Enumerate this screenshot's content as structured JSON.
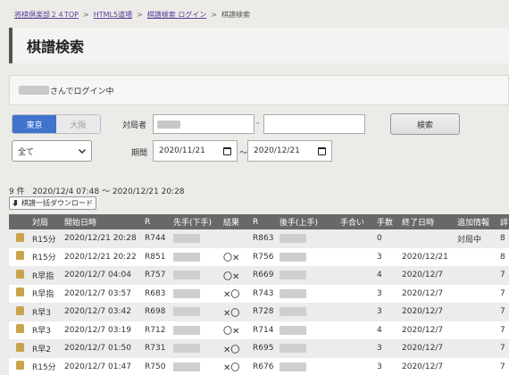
{
  "breadcrumb": {
    "items": [
      "将棋倶楽部２４TOP",
      "HTML5道場",
      "棋譜検索 ログイン",
      "棋譜検索"
    ],
    "sep": ">"
  },
  "page_title": "棋譜検索",
  "login": {
    "text": "さんでログイン中"
  },
  "region_tabs": {
    "tokyo": "東京",
    "osaka": "大阪"
  },
  "type_select": {
    "value": "全て"
  },
  "filters": {
    "opponent_label": "対局者",
    "dash": "-",
    "period_label": "期間",
    "date_from": "2020/11/21",
    "tilde": "～",
    "date_to": "2020/12/21",
    "search_label": "検索"
  },
  "results": {
    "count": "9 件",
    "range": "2020/12/4 07:48 ～ 2020/12/21 20:28",
    "download_label": "棋譜一括ダウンロード"
  },
  "table": {
    "headers": [
      "",
      "対局",
      "開始日時",
      "R",
      "先手(下手)",
      "結果",
      "R",
      "後手(上手)",
      "手合い",
      "手数",
      "終了日時",
      "追加情報",
      "詳"
    ],
    "rows": [
      {
        "game": "R15分",
        "start": "2020/12/21 20:28",
        "r1": "R744",
        "result": "",
        "r2": "R863",
        "handicap": "",
        "moves": "0",
        "end": "",
        "info": "対局中",
        "extra": "8"
      },
      {
        "game": "R15分",
        "start": "2020/12/21 20:22",
        "r1": "R851",
        "result": "〇✕",
        "r2": "R756",
        "handicap": "",
        "moves": "3",
        "end": "2020/12/21",
        "info": "",
        "extra": "8"
      },
      {
        "game": "R早指",
        "start": "2020/12/7 04:04",
        "r1": "R757",
        "result": "〇✕",
        "r2": "R669",
        "handicap": "",
        "moves": "4",
        "end": "2020/12/7",
        "info": "",
        "extra": "7"
      },
      {
        "game": "R早指",
        "start": "2020/12/7 03:57",
        "r1": "R683",
        "result": "✕〇",
        "r2": "R743",
        "handicap": "",
        "moves": "3",
        "end": "2020/12/7",
        "info": "",
        "extra": "7"
      },
      {
        "game": "R早3",
        "start": "2020/12/7 03:42",
        "r1": "R698",
        "result": "✕〇",
        "r2": "R728",
        "handicap": "",
        "moves": "3",
        "end": "2020/12/7",
        "info": "",
        "extra": "7"
      },
      {
        "game": "R早3",
        "start": "2020/12/7 03:19",
        "r1": "R712",
        "result": "〇✕",
        "r2": "R714",
        "handicap": "",
        "moves": "4",
        "end": "2020/12/7",
        "info": "",
        "extra": "7"
      },
      {
        "game": "R早2",
        "start": "2020/12/7 01:50",
        "r1": "R731",
        "result": "✕〇",
        "r2": "R695",
        "handicap": "",
        "moves": "3",
        "end": "2020/12/7",
        "info": "",
        "extra": "7"
      },
      {
        "game": "R15分",
        "start": "2020/12/7 01:47",
        "r1": "R750",
        "result": "✕〇",
        "r2": "R676",
        "handicap": "",
        "moves": "3",
        "end": "2020/12/7",
        "info": "",
        "extra": "7"
      }
    ]
  },
  "colors": {
    "accent": "#3f73cc",
    "header_bg": "#686868"
  }
}
